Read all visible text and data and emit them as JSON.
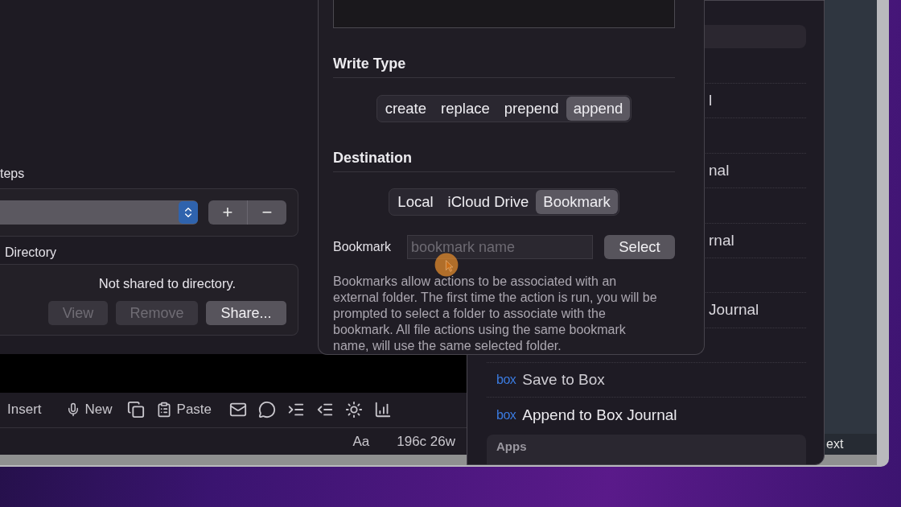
{
  "left_panel": {
    "steps_label": "teps",
    "add_label": "+",
    "remove_label": "−",
    "directory_label": "Directory",
    "directory_status": "Not shared to directory.",
    "directory_buttons": [
      {
        "label": "View",
        "disabled": true
      },
      {
        "label": "Remove",
        "disabled": true
      },
      {
        "label": "Share...",
        "disabled": false
      }
    ]
  },
  "sheet": {
    "write_type": {
      "title": "Write Type",
      "options": [
        {
          "label": "create",
          "selected": false
        },
        {
          "label": "replace",
          "selected": false
        },
        {
          "label": "prepend",
          "selected": false
        },
        {
          "label": "append",
          "selected": true
        }
      ]
    },
    "destination": {
      "title": "Destination",
      "options": [
        {
          "label": "Local",
          "selected": false
        },
        {
          "label": "iCloud Drive",
          "selected": false
        },
        {
          "label": "Bookmark",
          "selected": true
        }
      ]
    },
    "bookmark": {
      "label": "Bookmark",
      "placeholder": "bookmark name",
      "button": "Select"
    },
    "description": "Bookmarks allow actions to be associated with an external folder. The first time the action is run, you will be prompted to select a folder to associate with the bookmark. All file actions using the same bookmark name, will use the same selected folder."
  },
  "toolbar": {
    "buttons": [
      {
        "label": "Insert"
      },
      {
        "label": "New"
      },
      {
        "label": "Paste"
      }
    ]
  },
  "status_bar": {
    "font_button": "Aa",
    "counts": "196c 26w"
  },
  "actions_list": {
    "items": [
      {
        "kind": "partial",
        "label": "l"
      },
      {
        "kind": "partial",
        "label": "nal"
      },
      {
        "kind": "partial",
        "label": "rnal"
      },
      {
        "kind": "partial",
        "label": "Journal"
      },
      {
        "kind": "box",
        "logo": "box",
        "label": "Save to Box"
      },
      {
        "kind": "box",
        "logo": "box",
        "label": "Append to Box Journal"
      }
    ],
    "section": "Apps"
  },
  "side_label": "ext"
}
